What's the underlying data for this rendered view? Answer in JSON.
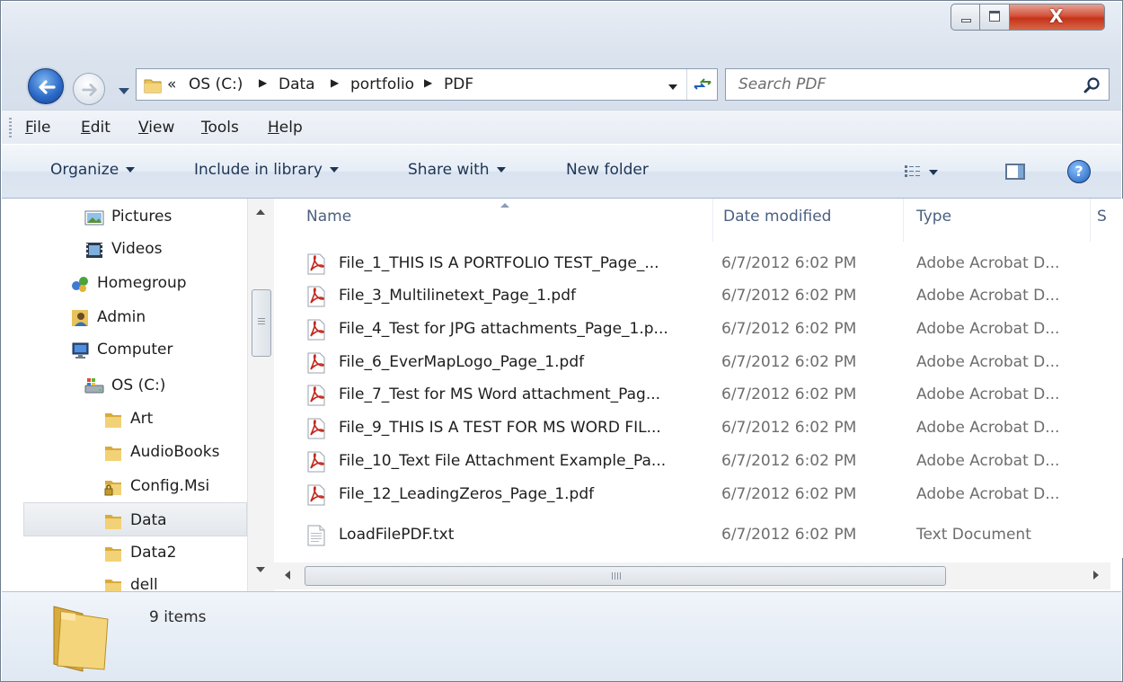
{
  "window": {
    "close_glyph": "X"
  },
  "address": {
    "overflow": "«",
    "crumbs": [
      "OS (C:)",
      "Data",
      "portfolio",
      "PDF"
    ]
  },
  "search": {
    "placeholder": "Search PDF"
  },
  "menu": {
    "file": {
      "accel": "F",
      "rest": "ile"
    },
    "edit": {
      "accel": "E",
      "rest": "dit"
    },
    "view": {
      "accel": "V",
      "rest": "iew"
    },
    "tools": {
      "accel": "T",
      "rest": "ools"
    },
    "help": {
      "accel": "H",
      "rest": "elp"
    }
  },
  "commands": {
    "organize": "Organize",
    "include": "Include in library",
    "share": "Share with",
    "new_folder": "New folder",
    "help_glyph": "?"
  },
  "tree": [
    {
      "label": "Pictures",
      "icon": "pictures-icon"
    },
    {
      "label": "Videos",
      "icon": "videos-icon"
    },
    {
      "label": "Homegroup",
      "icon": "homegroup-icon"
    },
    {
      "label": "Admin",
      "icon": "user-icon"
    },
    {
      "label": "Computer",
      "icon": "computer-icon"
    },
    {
      "label": "OS (C:)",
      "icon": "drive-icon"
    },
    {
      "label": "Art",
      "icon": "folder-icon"
    },
    {
      "label": "AudioBooks",
      "icon": "folder-icon"
    },
    {
      "label": "Config.Msi",
      "icon": "locked-folder-icon"
    },
    {
      "label": "Data",
      "icon": "folder-icon",
      "selected": true
    },
    {
      "label": "Data2",
      "icon": "folder-icon"
    },
    {
      "label": "dell",
      "icon": "folder-icon"
    }
  ],
  "columns": {
    "name": "Name",
    "date": "Date modified",
    "type": "Type",
    "size_partial": "S"
  },
  "files": [
    {
      "name": "File_1_THIS IS A PORTFOLIO TEST_Page_...",
      "date": "6/7/2012 6:02 PM",
      "type": "Adobe Acrobat D...",
      "icon": "pdf-icon"
    },
    {
      "name": "File_3_Multilinetext_Page_1.pdf",
      "date": "6/7/2012 6:02 PM",
      "type": "Adobe Acrobat D...",
      "icon": "pdf-icon"
    },
    {
      "name": "File_4_Test for JPG attachments_Page_1.p...",
      "date": "6/7/2012 6:02 PM",
      "type": "Adobe Acrobat D...",
      "icon": "pdf-icon"
    },
    {
      "name": "File_6_EverMapLogo_Page_1.pdf",
      "date": "6/7/2012 6:02 PM",
      "type": "Adobe Acrobat D...",
      "icon": "pdf-icon"
    },
    {
      "name": "File_7_Test for MS Word attachment_Pag...",
      "date": "6/7/2012 6:02 PM",
      "type": "Adobe Acrobat D...",
      "icon": "pdf-icon"
    },
    {
      "name": "File_9_THIS IS A TEST FOR MS WORD FIL...",
      "date": "6/7/2012 6:02 PM",
      "type": "Adobe Acrobat D...",
      "icon": "pdf-icon"
    },
    {
      "name": "File_10_Text File Attachment Example_Pa...",
      "date": "6/7/2012 6:02 PM",
      "type": "Adobe Acrobat D...",
      "icon": "pdf-icon"
    },
    {
      "name": "File_12_LeadingZeros_Page_1.pdf",
      "date": "6/7/2012 6:02 PM",
      "type": "Adobe Acrobat D...",
      "icon": "pdf-icon"
    },
    {
      "name": "LoadFilePDF.txt",
      "date": "6/7/2012 6:02 PM",
      "type": "Text Document",
      "icon": "text-file-icon"
    }
  ],
  "details": {
    "count": "9 items"
  },
  "colors": {
    "accent": "#2c6bc9",
    "pdf_red": "#c2271d",
    "folder": "#e8c35a"
  }
}
